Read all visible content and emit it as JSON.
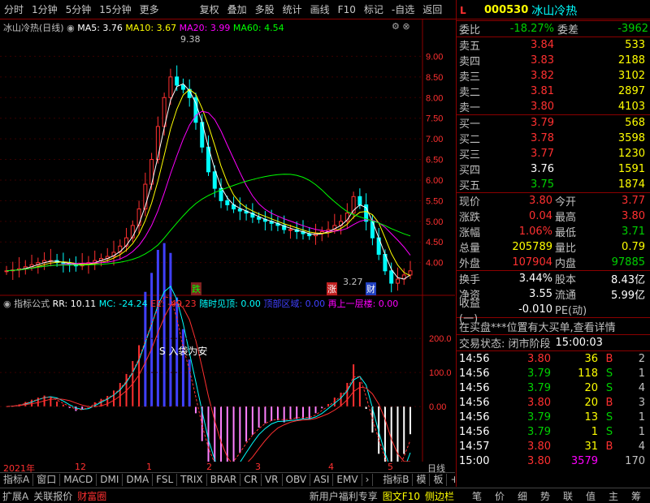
{
  "toolbar": {
    "items": [
      "分时",
      "1分钟",
      "5分钟",
      "15分钟",
      "更多",
      "复权",
      "叠加",
      "多股",
      "统计",
      "画线",
      "F10",
      "标记",
      "-自选",
      "返回"
    ]
  },
  "main": {
    "title": "冰山冷热(日线)",
    "ma": [
      {
        "label": "MA5: 3.76",
        "color": "#ffffff"
      },
      {
        "label": "MA10: 3.67",
        "color": "#ffff00"
      },
      {
        "label": "MA20: 3.99",
        "color": "#ff00ff"
      },
      {
        "label": "MA60: 4.54",
        "color": "#00ff00"
      }
    ],
    "price_axis": [
      "9.00",
      "8.50",
      "8.00",
      "7.50",
      "7.00",
      "6.50",
      "6.00",
      "5.50",
      "5.00",
      "4.50",
      "4.00"
    ],
    "high_label": "9.38",
    "low_label": "3.27",
    "markers": [
      "跌",
      "涨",
      "财"
    ]
  },
  "ind": {
    "title": "指标公式",
    "rr": "RR: 10.11",
    "mc": "MC: -24.24",
    "ee": "EE: -49.23",
    "l1": "随时见顶: 0.00",
    "l2": "顶部区域: 0.00",
    "l3": "再上一层楼: 0.00",
    "axis": [
      "200.0",
      "100.0",
      "0.00"
    ],
    "note": "S 入袋为安"
  },
  "xaxis": {
    "labels": [
      "2021年",
      "12",
      "1",
      "2",
      "3",
      "4",
      "5"
    ],
    "right": "日线"
  },
  "tabs": [
    "指标A",
    "窗口",
    "MACD",
    "DMI",
    "DMA",
    "FSL",
    "TRIX",
    "BRAR",
    "CR",
    "VR",
    "OBV",
    "ASI",
    "EMV"
  ],
  "tabs_right": [
    "指标B",
    "模",
    "板"
  ],
  "status": {
    "items": [
      "扩展A",
      "关联报价",
      "财富圈"
    ],
    "right": [
      "新用户福利专享",
      "图文F10",
      "侧边栏"
    ]
  },
  "quote": {
    "code": "000530",
    "name": "冰山冷热",
    "flag": "L",
    "wb": {
      "label": "委比",
      "value": "-18.27%",
      "label2": "委差",
      "value2": "-3962"
    },
    "sell": [
      {
        "l": "卖五",
        "p": "3.84",
        "v": "533"
      },
      {
        "l": "卖四",
        "p": "3.83",
        "v": "2188"
      },
      {
        "l": "卖三",
        "p": "3.82",
        "v": "3102"
      },
      {
        "l": "卖二",
        "p": "3.81",
        "v": "2897"
      },
      {
        "l": "卖一",
        "p": "3.80",
        "v": "4103"
      }
    ],
    "buy": [
      {
        "l": "买一",
        "p": "3.79",
        "v": "568"
      },
      {
        "l": "买二",
        "p": "3.78",
        "v": "3598"
      },
      {
        "l": "买三",
        "p": "3.77",
        "v": "1230"
      },
      {
        "l": "买四",
        "p": "3.76",
        "v": "1591"
      },
      {
        "l": "买五",
        "p": "3.75",
        "v": "1874"
      }
    ],
    "info": [
      [
        {
          "l": "现价",
          "v": "3.80",
          "c": "red"
        },
        {
          "l": "今开",
          "v": "3.77",
          "c": "red"
        }
      ],
      [
        {
          "l": "涨跌",
          "v": "0.04",
          "c": "red"
        },
        {
          "l": "最高",
          "v": "3.80",
          "c": "red"
        }
      ],
      [
        {
          "l": "涨幅",
          "v": "1.06%",
          "c": "red"
        },
        {
          "l": "最低",
          "v": "3.71",
          "c": "grn"
        }
      ],
      [
        {
          "l": "总量",
          "v": "205789",
          "c": "yel"
        },
        {
          "l": "量比",
          "v": "0.79",
          "c": "yel"
        }
      ],
      [
        {
          "l": "外盘",
          "v": "107904",
          "c": "red"
        },
        {
          "l": "内盘",
          "v": "97885",
          "c": "grn"
        }
      ]
    ],
    "info2": [
      [
        {
          "l": "换手",
          "v": "3.44%",
          "c": "wht"
        },
        {
          "l": "股本",
          "v": "8.43亿",
          "c": "wht"
        }
      ],
      [
        {
          "l": "净资",
          "v": "3.55",
          "c": "wht"
        },
        {
          "l": "流通",
          "v": "5.99亿",
          "c": "wht"
        }
      ],
      [
        {
          "l": "收益(一)",
          "v": "-0.010",
          "c": "wht"
        },
        {
          "l": "PE(动)",
          "v": "",
          "c": "wht"
        }
      ]
    ],
    "notice": "在买盘***位置有大买单,查看详情",
    "state": "交易状态: 闭市阶段",
    "state_time": "15:00:03",
    "ticks": [
      {
        "t": "14:56",
        "p": "3.80",
        "v": "36",
        "s": "B",
        "n": "2"
      },
      {
        "t": "14:56",
        "p": "3.79",
        "v": "118",
        "s": "S",
        "n": "1"
      },
      {
        "t": "14:56",
        "p": "3.79",
        "v": "20",
        "s": "S",
        "n": "4"
      },
      {
        "t": "14:56",
        "p": "3.80",
        "v": "20",
        "s": "B",
        "n": "3"
      },
      {
        "t": "14:56",
        "p": "3.79",
        "v": "13",
        "s": "S",
        "n": "1"
      },
      {
        "t": "14:56",
        "p": "3.79",
        "v": "1",
        "s": "S",
        "n": "1"
      },
      {
        "t": "14:57",
        "p": "3.80",
        "v": "31",
        "s": "B",
        "n": "4"
      },
      {
        "t": "15:00",
        "p": "3.80",
        "v": "3579",
        "s": "",
        "n": "170"
      }
    ],
    "bottom_tabs": [
      "笔",
      "价",
      "细",
      "势",
      "联",
      "值",
      "主",
      "筹"
    ]
  },
  "chart_data": {
    "type": "line",
    "title": "冰山冷热(日线)",
    "close": [
      3.8,
      3.82,
      3.85,
      3.9,
      3.95,
      4.0,
      4.05,
      4.05,
      4.0,
      3.98,
      3.95,
      3.92,
      3.95,
      4.0,
      4.05,
      4.1,
      4.15,
      4.25,
      4.4,
      4.6,
      4.9,
      5.3,
      5.9,
      6.5,
      7.3,
      8.0,
      8.5,
      8.3,
      8.2,
      8.0,
      7.4,
      6.8,
      6.2,
      5.8,
      5.5,
      5.4,
      5.3,
      5.25,
      5.2,
      5.1,
      5.05,
      5.0,
      4.95,
      4.9,
      4.8,
      4.8,
      4.75,
      4.7,
      4.65,
      4.7,
      4.75,
      4.8,
      4.9,
      5.0,
      5.2,
      5.6,
      5.4,
      5.0,
      4.6,
      4.2,
      3.8,
      3.5,
      3.6,
      3.7,
      3.8
    ],
    "ylim": [
      3.6,
      9.5
    ],
    "osc": {
      "ylim": [
        -150,
        260
      ]
    }
  }
}
